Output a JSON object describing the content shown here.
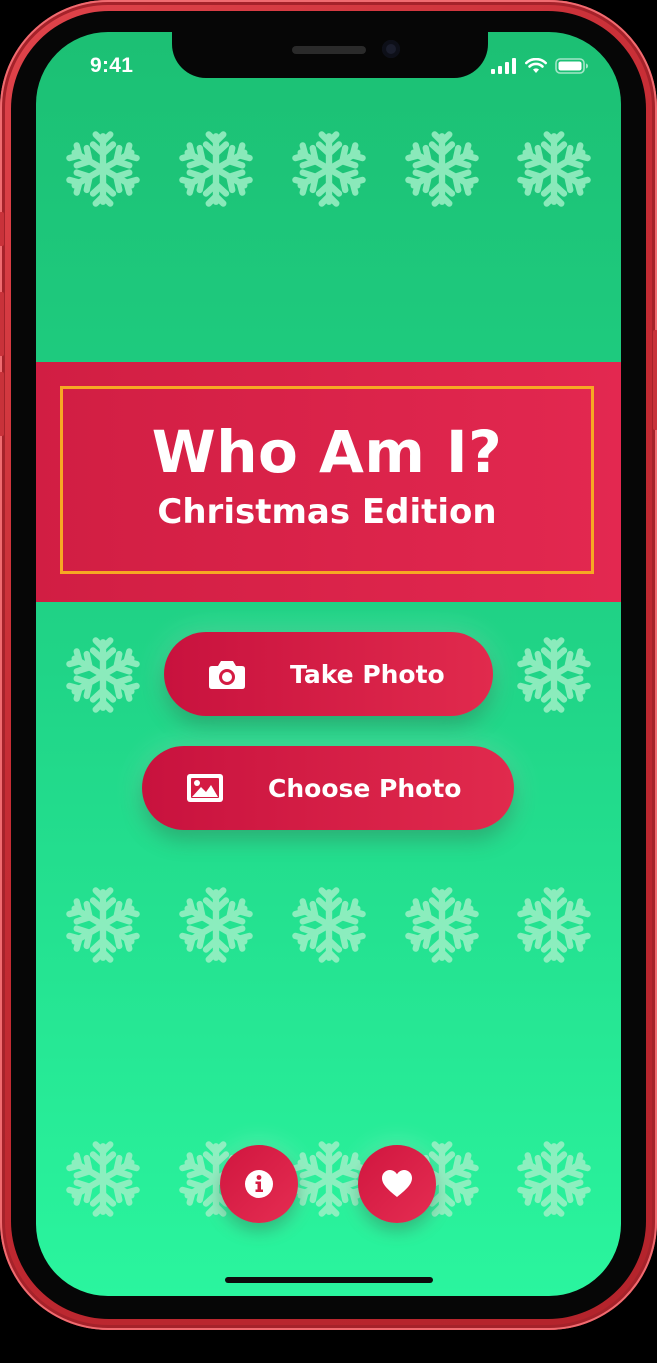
{
  "status_bar": {
    "time": "9:41",
    "icons": [
      "signal-icon",
      "wifi-icon",
      "battery-icon"
    ]
  },
  "banner": {
    "title": "Who Am I?",
    "subtitle": "Christmas Edition"
  },
  "actions": {
    "take_photo": {
      "label": "Take Photo",
      "icon": "camera-icon"
    },
    "choose_photo": {
      "label": "Choose Photo",
      "icon": "image-icon"
    }
  },
  "bottom_buttons": [
    {
      "icon": "info-icon"
    },
    {
      "icon": "heart-icon"
    }
  ],
  "colors": {
    "background_top": "#1cc074",
    "background_bottom": "#2af59e",
    "banner": "#d11e43",
    "banner_border": "#f7a823",
    "button": "#d11e43",
    "snowflake": "#9ef0c6",
    "frame": "#c52c34"
  }
}
